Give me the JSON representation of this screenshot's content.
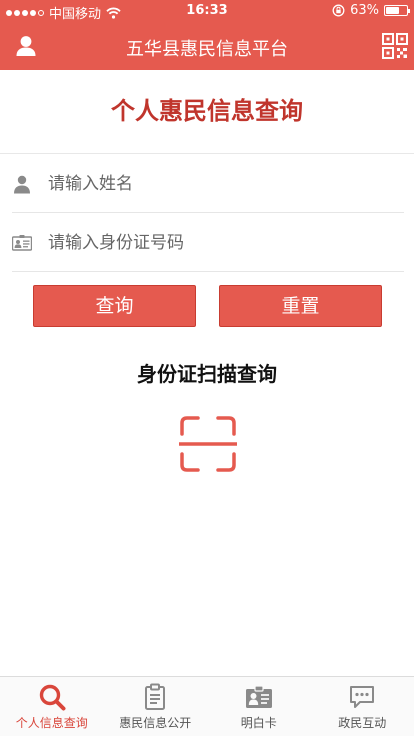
{
  "status_bar": {
    "carrier": "中国移动",
    "time": "16:33",
    "battery_percent": "63%",
    "battery_level": 0.63,
    "signal_bars": 4
  },
  "header": {
    "title": "五华县惠民信息平台",
    "left_icon": "user-icon",
    "right_icon": "qr-code-icon"
  },
  "form": {
    "title": "个人惠民信息查询",
    "name_field": {
      "placeholder": "请输入姓名",
      "value": "",
      "icon": "person-icon"
    },
    "id_field": {
      "placeholder": "请输入身份证号码",
      "value": "",
      "icon": "id-card-icon"
    },
    "query_label": "查询",
    "reset_label": "重置"
  },
  "scan": {
    "heading": "身份证扫描查询",
    "icon": "scan-frame-icon"
  },
  "tabs": [
    {
      "label": "个人信息查询",
      "icon": "search-icon",
      "active": true
    },
    {
      "label": "惠民信息公开",
      "icon": "clipboard-icon",
      "active": false
    },
    {
      "label": "明白卡",
      "icon": "id-card-icon",
      "active": false
    },
    {
      "label": "政民互动",
      "icon": "chat-icon",
      "active": false
    }
  ],
  "colors": {
    "brand": "#e55a4f",
    "title_red": "#c0352c",
    "active_tab": "#d9463b",
    "icon_gray": "#8a8a8a"
  }
}
